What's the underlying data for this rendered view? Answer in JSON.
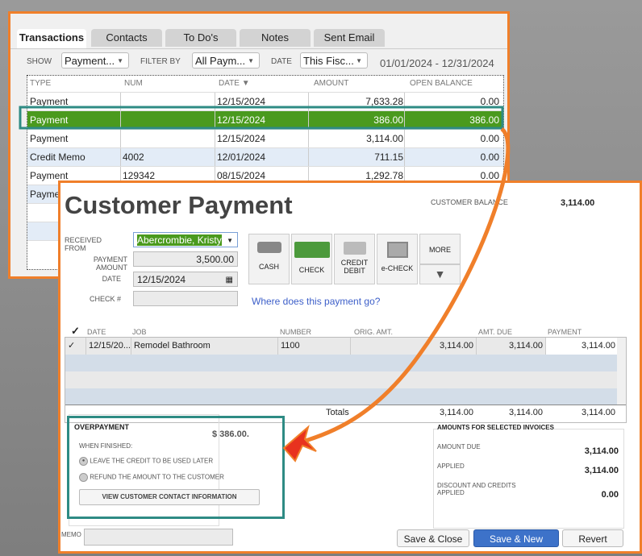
{
  "back": {
    "tabs": [
      "Transactions",
      "Contacts",
      "To Do's",
      "Notes",
      "Sent Email"
    ],
    "show_label": "SHOW",
    "show_value": "Payment...",
    "filter_label": "FILTER BY",
    "filter_value": "All Paym...",
    "date_label": "DATE",
    "date_value": "This Fisc...",
    "date_range": "01/01/2024 - 12/31/2024",
    "columns": [
      "TYPE",
      "NUM",
      "DATE",
      "AMOUNT",
      "OPEN BALANCE"
    ],
    "rows": [
      {
        "type": "Payment",
        "num": "",
        "date": "12/15/2024",
        "amount": "7,633.28",
        "open": "0.00"
      },
      {
        "type": "Payment",
        "num": "",
        "date": "12/15/2024",
        "amount": "386.00",
        "open": "386.00",
        "selected": true
      },
      {
        "type": "Payment",
        "num": "",
        "date": "12/15/2024",
        "amount": "3,114.00",
        "open": "0.00"
      },
      {
        "type": "Credit Memo",
        "num": "4002",
        "date": "12/01/2024",
        "amount": "711.15",
        "open": "0.00"
      },
      {
        "type": "Payment",
        "num": "129342",
        "date": "08/15/2024",
        "amount": "1,292.78",
        "open": "0.00"
      },
      {
        "type": "Payme",
        "num": "",
        "date": "",
        "amount": "",
        "open": ""
      }
    ]
  },
  "front": {
    "title": "Customer Payment",
    "balance_label": "CUSTOMER BALANCE",
    "balance_value": "3,114.00",
    "received_from_label": "RECEIVED FROM",
    "received_from": "Abercrombie, Kristy",
    "amount_label": "PAYMENT AMOUNT",
    "amount": "3,500.00",
    "date_label": "DATE",
    "date": "12/15/2024",
    "check_label": "CHECK #",
    "check": "",
    "methods": [
      "CASH",
      "CHECK",
      "CREDIT DEBIT",
      "e-CHECK"
    ],
    "more": "MORE",
    "where_link": "Where does this payment go?",
    "columns": [
      "DATE",
      "JOB",
      "NUMBER",
      "ORIG. AMT.",
      "AMT. DUE",
      "PAYMENT"
    ],
    "invoice": {
      "date": "12/15/20...",
      "job": "Remodel Bathroom",
      "number": "1100",
      "orig": "3,114.00",
      "due": "3,114.00",
      "payment": "3,114.00"
    },
    "totals_label": "Totals",
    "totals": [
      "3,114.00",
      "3,114.00",
      "3,114.00"
    ],
    "overpayment": {
      "title": "OVERPAYMENT",
      "amount": "$ 386.00.",
      "when": "WHEN FINISHED:",
      "opt1": "LEAVE THE CREDIT TO BE USED LATER",
      "opt2": "REFUND THE AMOUNT TO THE CUSTOMER",
      "selected": "opt1",
      "view_btn": "VIEW CUSTOMER CONTACT INFORMATION"
    },
    "amounts": {
      "title": "AMOUNTS FOR SELECTED INVOICES",
      "due_label": "AMOUNT DUE",
      "due": "3,114.00",
      "applied_label": "APPLIED",
      "applied": "3,114.00",
      "disc_label": "DISCOUNT AND CREDITS APPLIED",
      "disc": "0.00"
    },
    "memo_label": "MEMO",
    "save_close": "Save & Close",
    "save_new": "Save & New",
    "revert": "Revert"
  },
  "colors": {
    "accent_orange": "#f07f2a",
    "selected_green": "#4a9a1e",
    "teal_highlight": "#2e8b84",
    "primary_blue": "#3d72c9"
  }
}
